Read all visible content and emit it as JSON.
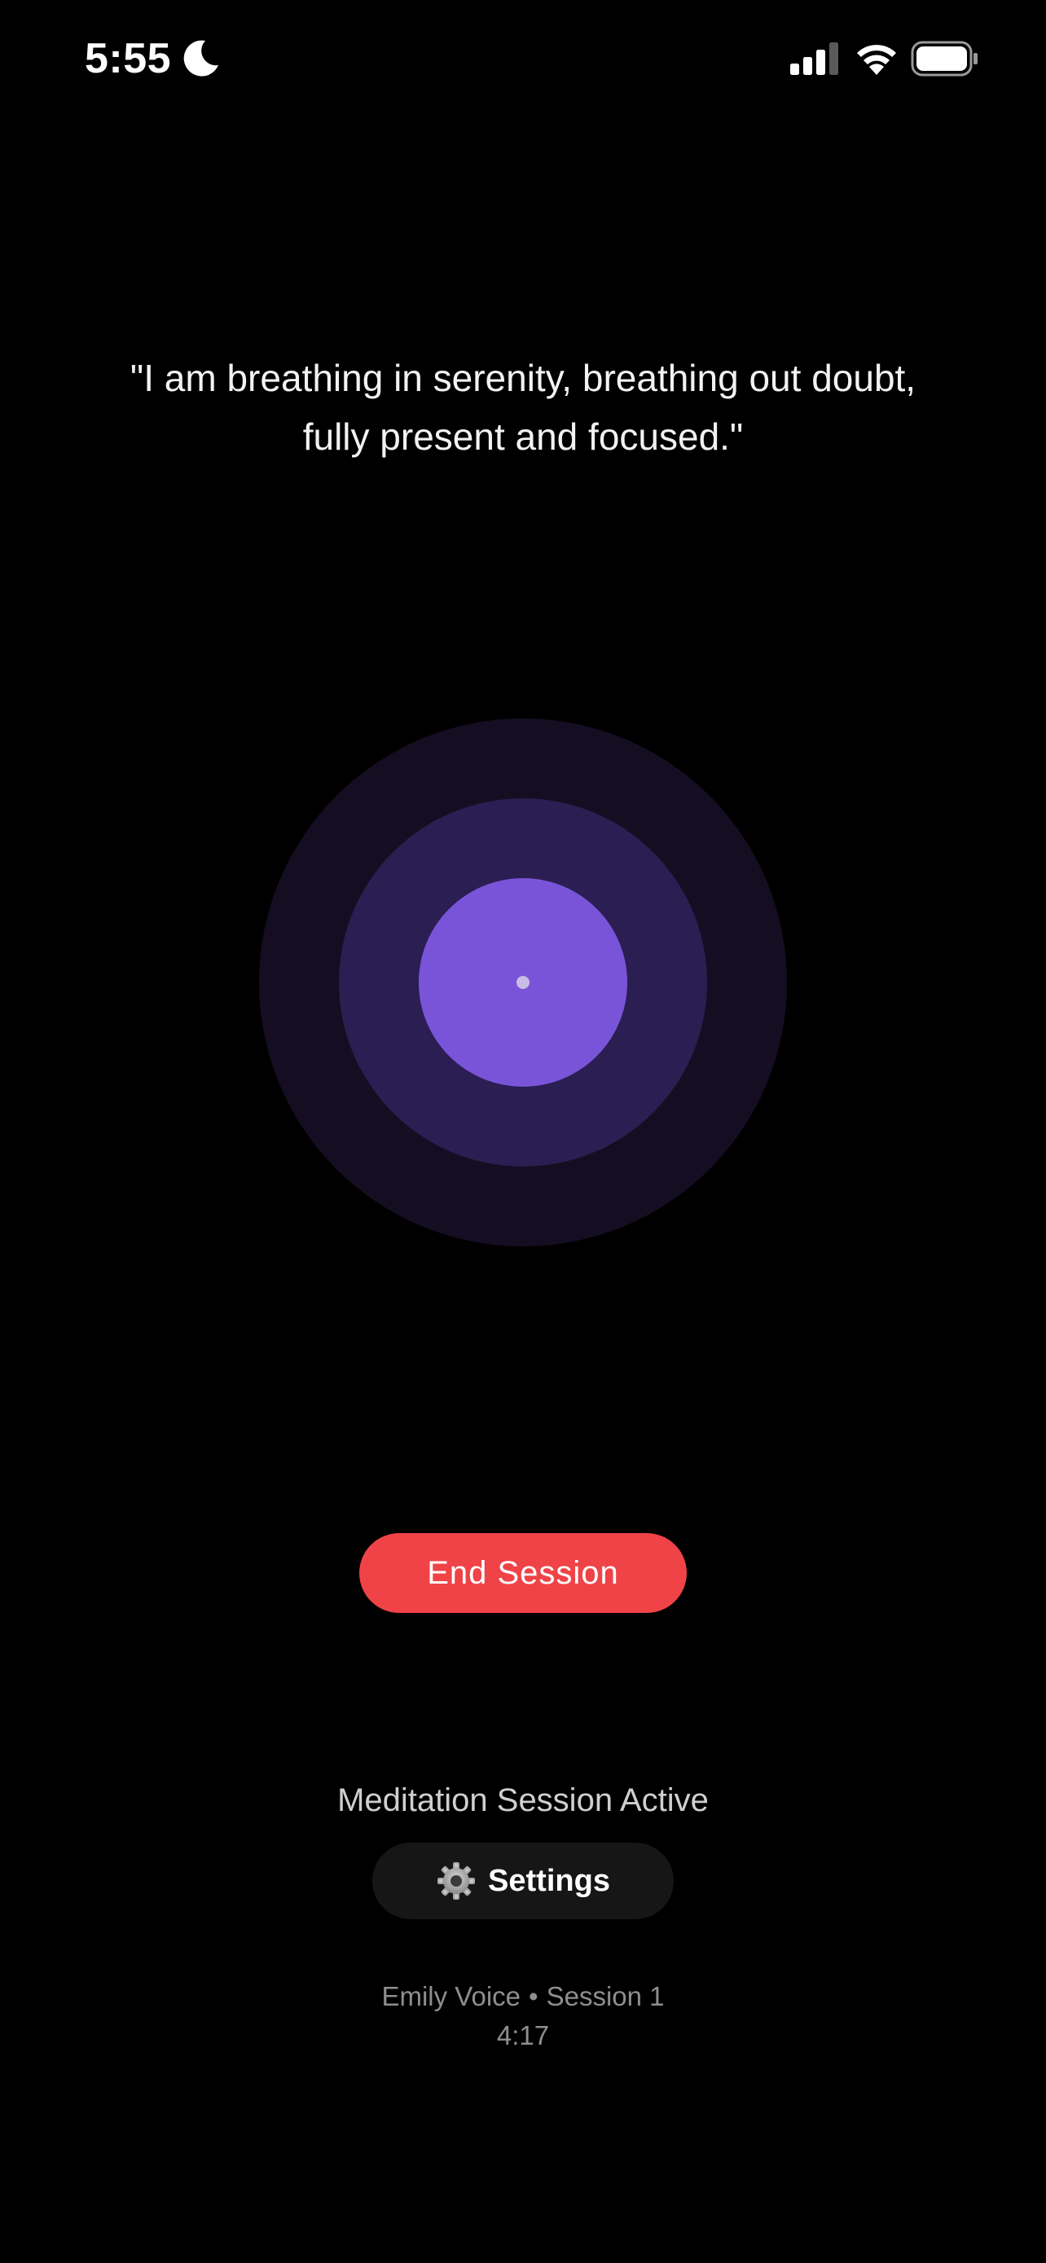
{
  "status_bar": {
    "time": "5:55",
    "icons": [
      "moon-icon",
      "signal-icon",
      "wifi-icon",
      "battery-icon"
    ]
  },
  "affirmation": {
    "line1": "\"I am breathing in serenity, breathing out doubt,",
    "line2": "fully present and focused.\""
  },
  "orb": {
    "colors": {
      "outer": "#150e22",
      "middle": "#2a1e52",
      "inner": "#7a54d8",
      "dot": "#c8bde6"
    }
  },
  "end_button": {
    "label": "End Session",
    "color": "#ef4347"
  },
  "session": {
    "status": "Meditation Session Active",
    "voice": "Emily Voice",
    "separator": "•",
    "session_name": "Session 1",
    "timer": "4:17"
  },
  "settings_button": {
    "label": "Settings",
    "icon": "gear-icon"
  }
}
